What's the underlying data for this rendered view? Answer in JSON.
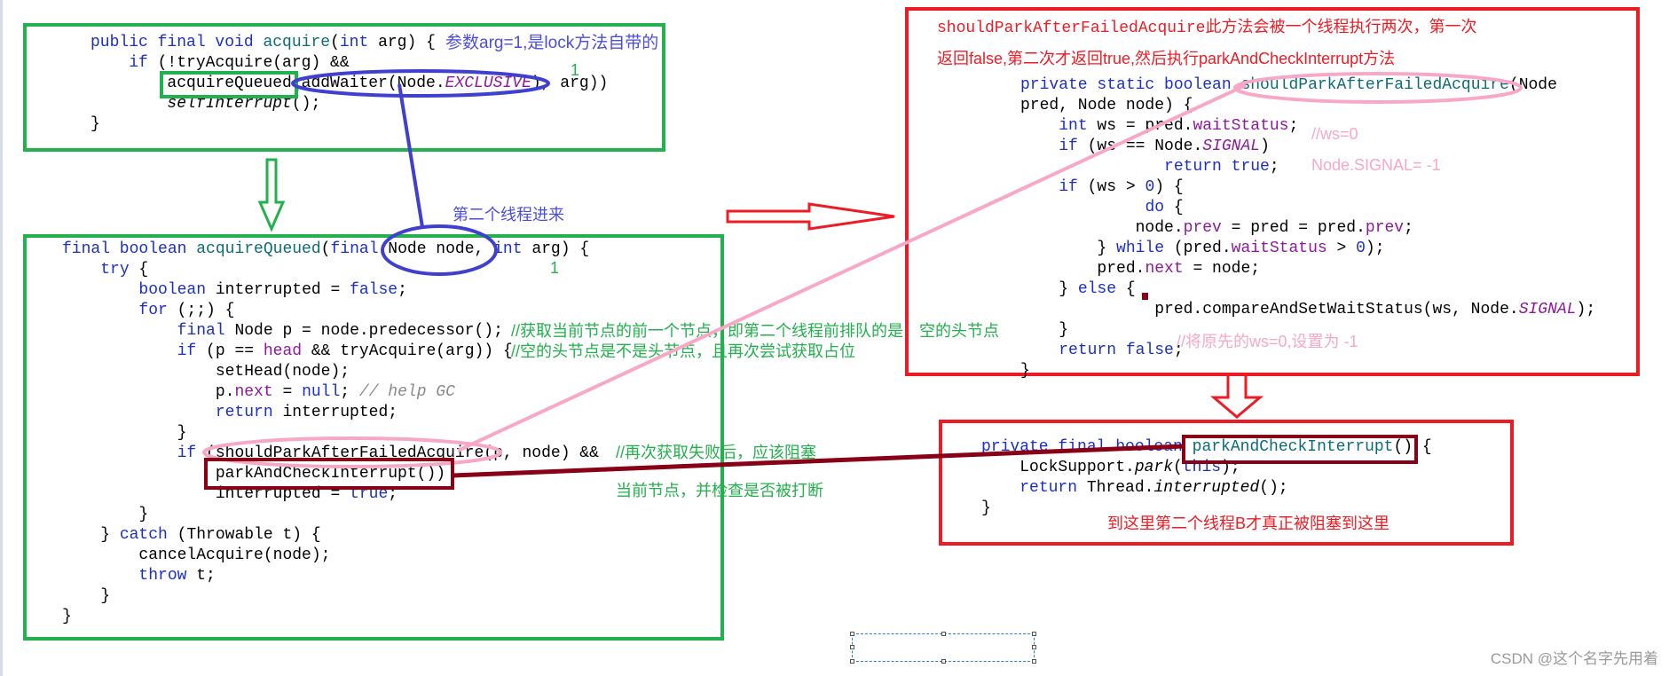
{
  "colors": {
    "green_box": "#22b14c",
    "red_box": "#ed1c24",
    "blue_mark": "#4040d0",
    "pink_mark": "#f7a8c6",
    "darkred_mark": "#880015"
  },
  "box_acquire": {
    "lines": [
      [
        [
          "public final void ",
          "kw"
        ],
        [
          "acquire",
          "fn"
        ],
        [
          "(",
          "plain"
        ],
        [
          "int",
          "kw"
        ],
        [
          " arg) {",
          "plain"
        ]
      ],
      [
        [
          "    ",
          "plain"
        ],
        [
          "if",
          "kw"
        ],
        [
          " (!tryAcquire(arg) &&",
          "plain"
        ]
      ],
      [
        [
          "        acquireQueued(addWaiter(Node.",
          "plain"
        ],
        [
          "EXCLUSIVE",
          "static"
        ],
        [
          "), arg))",
          "plain"
        ]
      ],
      [
        [
          "        ",
          "plain"
        ],
        [
          "selfInterrupt",
          "italic"
        ],
        [
          "();",
          "plain"
        ]
      ],
      [
        [
          "}",
          "plain"
        ]
      ]
    ],
    "note_arg": "参数arg=1,是lock方法自带的",
    "note_one": "1"
  },
  "note_second_thread": "第二个线程进来",
  "box_acquire_queued": {
    "lines": [
      [
        [
          "final boolean ",
          "kw"
        ],
        [
          "acquireQueued",
          "fn"
        ],
        [
          "(",
          "plain"
        ],
        [
          "final",
          "kw"
        ],
        [
          " Node node, ",
          "plain"
        ],
        [
          "int",
          "kw"
        ],
        [
          " arg) {",
          "plain"
        ]
      ],
      [
        [
          "    ",
          "plain"
        ],
        [
          "try",
          "kw"
        ],
        [
          " {",
          "plain"
        ]
      ],
      [
        [
          "        ",
          "plain"
        ],
        [
          "boolean",
          "kw"
        ],
        [
          " interrupted = ",
          "plain"
        ],
        [
          "false",
          "kw"
        ],
        [
          ";",
          "plain"
        ]
      ],
      [
        [
          "        ",
          "plain"
        ],
        [
          "for",
          "kw"
        ],
        [
          " (;;) {",
          "plain"
        ]
      ],
      [
        [
          "            ",
          "plain"
        ],
        [
          "final",
          "kw"
        ],
        [
          " Node p = node.predecessor();",
          "plain"
        ]
      ],
      [
        [
          "            ",
          "plain"
        ],
        [
          "if",
          "kw"
        ],
        [
          " (p == ",
          "plain"
        ],
        [
          "head",
          "field"
        ],
        [
          " && tryAcquire(arg)) {",
          "plain"
        ]
      ],
      [
        [
          "                setHead(node);",
          "plain"
        ]
      ],
      [
        [
          "                p.",
          "plain"
        ],
        [
          "next",
          "field"
        ],
        [
          " = ",
          "plain"
        ],
        [
          "null",
          "kw"
        ],
        [
          "; ",
          "plain"
        ],
        [
          "// help GC",
          "comment"
        ]
      ],
      [
        [
          "                ",
          "plain"
        ],
        [
          "return",
          "kw"
        ],
        [
          " interrupted;",
          "plain"
        ]
      ],
      [
        [
          "            }",
          "plain"
        ]
      ],
      [
        [
          "            ",
          "plain"
        ],
        [
          "if",
          "kw"
        ],
        [
          " (shouldParkAfterFailedAcquire(p, node) &&",
          "plain"
        ]
      ],
      [
        [
          "                parkAndCheckInterrupt())",
          "plain"
        ]
      ],
      [
        [
          "                interrupted = ",
          "plain"
        ],
        [
          "true",
          "kw"
        ],
        [
          ";",
          "plain"
        ]
      ],
      [
        [
          "        }",
          "plain"
        ]
      ],
      [
        [
          "    } ",
          "plain"
        ],
        [
          "catch",
          "kw"
        ],
        [
          " (Throwable t) {",
          "plain"
        ]
      ],
      [
        [
          "        cancelAcquire(node);",
          "plain"
        ]
      ],
      [
        [
          "        ",
          "plain"
        ],
        [
          "throw",
          "kw"
        ],
        [
          " t;",
          "plain"
        ]
      ],
      [
        [
          "    }",
          "plain"
        ]
      ],
      [
        [
          "}",
          "plain"
        ]
      ]
    ],
    "note_one": "1",
    "comment_predecessor": "//获取当前节点的前一个节点，即第二个线程前排队的是：空的头节点",
    "comment_head": "//空的头节点是不是头节点，且再次尝试获取占位",
    "comment_block_1": "//再次获取失败后，应该阻塞",
    "comment_block_2": "当前节点，并检查是否被打断"
  },
  "box_should_park": {
    "heading_1_method": "shouldParkAfterFailedAcquire",
    "heading_1_rest": "此方法会被一个线程执行两次，第一次",
    "heading_2": "返回false,第二次才返回true,然后执行parkAndCheckInterrupt方法",
    "lines": [
      [
        [
          "private static boolean ",
          "kw"
        ],
        [
          "shouldParkAfterFailedAcquire",
          "fn"
        ],
        [
          "(Node",
          "plain"
        ]
      ],
      [
        [
          "pred, Node node) {",
          "plain"
        ]
      ],
      [
        [
          "    ",
          "plain"
        ],
        [
          "int",
          "kw"
        ],
        [
          " ws = pred.",
          "plain"
        ],
        [
          "waitStatus",
          "field"
        ],
        [
          ";",
          "plain"
        ]
      ],
      [
        [
          "    ",
          "plain"
        ],
        [
          "if",
          "kw"
        ],
        [
          " (ws == Node.",
          "plain"
        ],
        [
          "SIGNAL",
          "static"
        ],
        [
          ")",
          "plain"
        ]
      ],
      [
        [
          "               ",
          "plain"
        ],
        [
          "return true",
          "kw"
        ],
        [
          ";",
          "plain"
        ]
      ],
      [
        [
          "    ",
          "plain"
        ],
        [
          "if",
          "kw"
        ],
        [
          " (ws > ",
          "plain"
        ],
        [
          "0",
          "kw"
        ],
        [
          ") {",
          "plain"
        ]
      ],
      [
        [
          "             ",
          "plain"
        ],
        [
          "do",
          "kw"
        ],
        [
          " {",
          "plain"
        ]
      ],
      [
        [
          "            node.",
          "plain"
        ],
        [
          "prev",
          "field"
        ],
        [
          " = pred = pred.",
          "plain"
        ],
        [
          "prev",
          "field"
        ],
        [
          ";",
          "plain"
        ]
      ],
      [
        [
          "        } ",
          "plain"
        ],
        [
          "while",
          "kw"
        ],
        [
          " (pred.",
          "plain"
        ],
        [
          "waitStatus",
          "field"
        ],
        [
          " > ",
          "plain"
        ],
        [
          "0",
          "kw"
        ],
        [
          ");",
          "plain"
        ]
      ],
      [
        [
          "        pred.",
          "plain"
        ],
        [
          "next",
          "field"
        ],
        [
          " = node;",
          "plain"
        ]
      ],
      [
        [
          "    } ",
          "plain"
        ],
        [
          "else",
          "kw"
        ],
        [
          " {",
          "plain"
        ]
      ],
      [
        [
          "              pred.compareAndSetWaitStatus(ws, Node.",
          "plain"
        ],
        [
          "SIGNAL",
          "static"
        ],
        [
          ");",
          "plain"
        ]
      ],
      [
        [
          "    }",
          "plain"
        ]
      ],
      [
        [
          "    ",
          "plain"
        ],
        [
          "return false",
          "kw"
        ],
        [
          ";",
          "plain"
        ]
      ],
      [
        [
          "}",
          "plain"
        ]
      ]
    ],
    "note_ws": "//ws=0",
    "note_signal": "Node.SIGNAL= -1",
    "note_set": "//将原先的ws=0,设置为 -1"
  },
  "box_park": {
    "lines": [
      [
        [
          "private final boolean ",
          "kw"
        ],
        [
          "parkAndCheckInterrupt",
          "fn"
        ],
        [
          "() {",
          "plain"
        ]
      ],
      [
        [
          "    LockSupport.",
          "plain"
        ],
        [
          "park",
          "italic"
        ],
        [
          "(",
          "plain"
        ],
        [
          "this",
          "kw"
        ],
        [
          ");",
          "plain"
        ]
      ],
      [
        [
          "    ",
          "plain"
        ],
        [
          "return",
          "kw"
        ],
        [
          " Thread.",
          "plain"
        ],
        [
          "interrupted",
          "italic"
        ],
        [
          "();",
          "plain"
        ]
      ],
      [
        [
          "}",
          "plain"
        ]
      ]
    ],
    "note_blocked": "到这里第二个线程B才真正被阻塞到这里"
  },
  "watermark": "CSDN @这个名字先用着"
}
